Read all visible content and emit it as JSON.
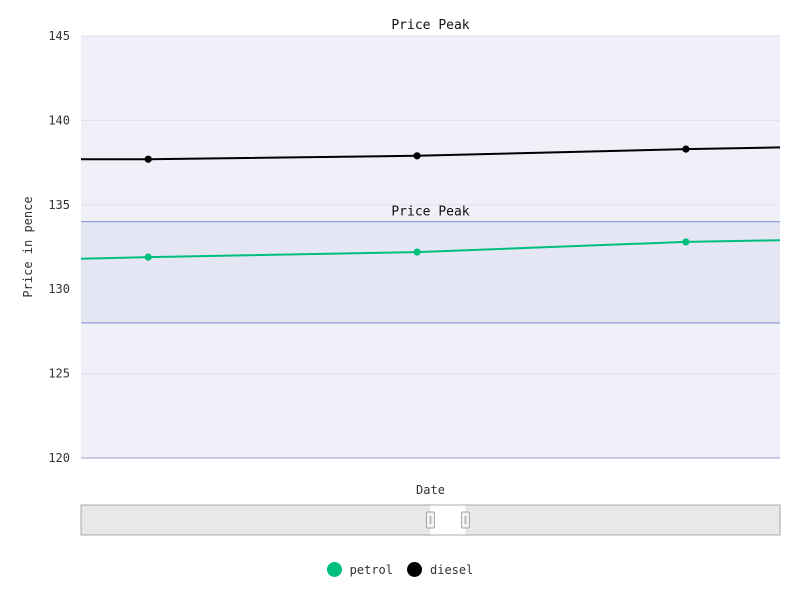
{
  "chart_data": {
    "type": "line",
    "title": "",
    "xlabel": "Date",
    "ylabel": "Price in pence",
    "ylim": [
      120,
      145
    ],
    "yticks": [
      120,
      125,
      130,
      135,
      140,
      145
    ],
    "grid": true,
    "legend_position": "bottom-center",
    "x": [
      1,
      2,
      3
    ],
    "series": [
      {
        "name": "petrol",
        "color": "#00bf7d",
        "values": [
          131.9,
          132.2,
          132.8
        ],
        "line_start": 131.8,
        "line_end": 132.9
      },
      {
        "name": "diesel",
        "color": "#000000",
        "values": [
          137.7,
          137.9,
          138.3
        ],
        "line_start": 137.7,
        "line_end": 138.4
      }
    ],
    "annotations": [
      {
        "type": "band",
        "label": "Price Peak",
        "y_from": 128,
        "y_to": 134,
        "color": "#7b8bd4"
      },
      {
        "type": "top-label",
        "label": "Price Peak"
      }
    ]
  },
  "colors": {
    "plot_background": "#eff0f8",
    "band_fill": "#e4e6f3",
    "band_edge": "#8a97d8",
    "gridline": "#dfe1ee",
    "axis": "#b8bde0",
    "slider_track": "#e8e8e8",
    "slider_border": "#a9a9a9",
    "slider_window": "#ffffff"
  },
  "range_selector": {
    "selection_from": 0.5,
    "selection_to": 0.55
  }
}
